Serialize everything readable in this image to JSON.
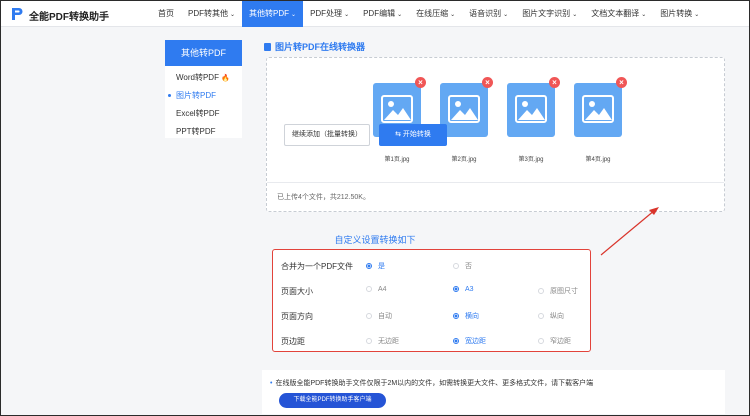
{
  "header": {
    "brand": "全能PDF转换助手",
    "nav": [
      {
        "label": "首页",
        "chev": ""
      },
      {
        "label": "PDF转其他",
        "chev": "⌄"
      },
      {
        "label": "其他转PDF",
        "chev": "⌄",
        "active": true
      },
      {
        "label": "PDF处理",
        "chev": "⌄"
      },
      {
        "label": "PDF编辑",
        "chev": "⌄"
      },
      {
        "label": "在线压缩",
        "chev": "⌄"
      },
      {
        "label": "语音识别",
        "chev": "⌄"
      },
      {
        "label": "图片文字识别",
        "chev": "⌄"
      },
      {
        "label": "文档文本翻译",
        "chev": "⌄"
      },
      {
        "label": "图片转换",
        "chev": "⌄"
      }
    ]
  },
  "sidebar": {
    "title": "其他转PDF",
    "items": [
      {
        "label": "Word转PDF",
        "hot": "🔥"
      },
      {
        "label": "图片转PDF"
      },
      {
        "label": "Excel转PDF"
      },
      {
        "label": "PPT转PDF"
      }
    ]
  },
  "main": {
    "title": "图片转PDF在线转换器",
    "files": [
      "第1页.jpg",
      "第2页.jpg",
      "第3页.jpg",
      "第4页.jpg"
    ],
    "delete_symbol": "×",
    "summary": "已上传4个文件，共212.50K。",
    "add_button": "继续添加（批量转换）",
    "start_button": "开始转换"
  },
  "settings": {
    "title": "自定义设置转换如下",
    "rows": [
      {
        "label": "合并为一个PDF文件",
        "options": [
          "是",
          "否"
        ],
        "selected": 0
      },
      {
        "label": "页面大小",
        "options": [
          "A4",
          "A3",
          "原图尺寸"
        ],
        "selected": 1
      },
      {
        "label": "页面方向",
        "options": [
          "自动",
          "横向",
          "纵向"
        ],
        "selected": 1
      },
      {
        "label": "页边距",
        "options": [
          "无边距",
          "宽边距",
          "窄边距"
        ],
        "selected": 1
      }
    ]
  },
  "notice": {
    "bullet": "•",
    "text": "在线版全能PDF转换助手文件仅限于2M以内的文件，如需转换更大文件、更多格式文件，请下载客户端",
    "download_button": "下载全能PDF转换助手客户端"
  },
  "colors": {
    "accent": "#2f7bf0",
    "highlight": "#e2433b",
    "thumb": "#63a8f3"
  },
  "icons": {
    "logo": "logo-icon",
    "file": "image-file-icon",
    "delete": "delete-icon",
    "start": "convert-icon",
    "arrow": "annotation-arrow-icon"
  }
}
